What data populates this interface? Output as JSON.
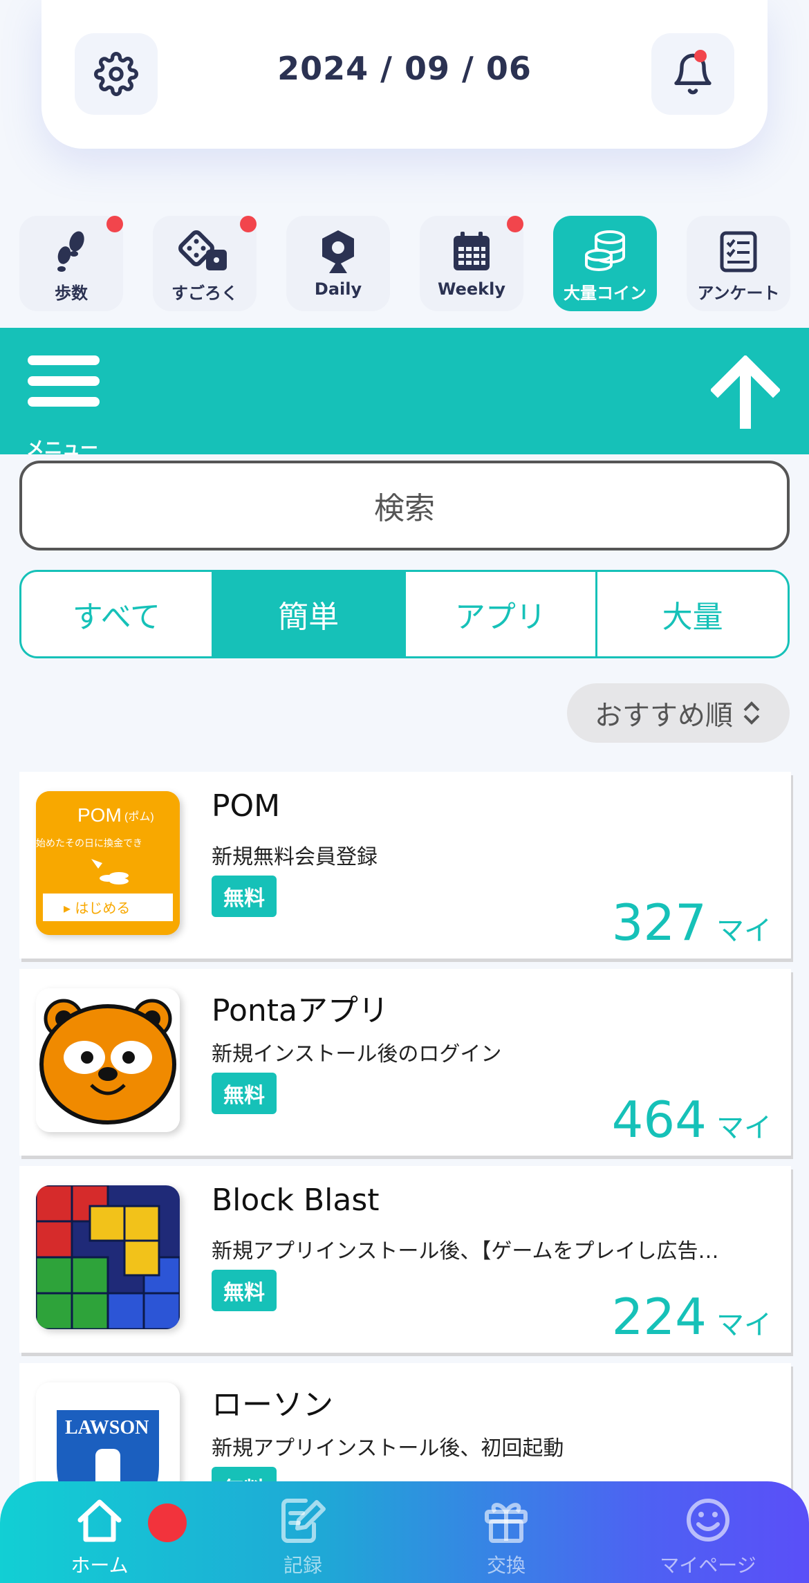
{
  "header": {
    "date": "2024 / 09 / 06"
  },
  "categories": [
    {
      "label": "歩数",
      "icon": "footprints-icon",
      "badge": true
    },
    {
      "label": "すごろく",
      "icon": "dice-icon",
      "badge": true
    },
    {
      "label": "Daily",
      "icon": "roulette-icon",
      "badge": false
    },
    {
      "label": "Weekly",
      "icon": "calendar-icon",
      "badge": true
    },
    {
      "label": "大量コイン",
      "icon": "coins-icon",
      "badge": false,
      "active": true
    },
    {
      "label": "アンケート",
      "icon": "checklist-icon",
      "badge": false
    }
  ],
  "toolbar": {
    "menu_label": "メニュー"
  },
  "search": {
    "placeholder": "検索"
  },
  "tabs": [
    {
      "label": "すべて"
    },
    {
      "label": "簡単",
      "active": true
    },
    {
      "label": "アプリ"
    },
    {
      "label": "大量"
    }
  ],
  "sort": {
    "label": "おすすめ順"
  },
  "offers": [
    {
      "title": "POM",
      "desc": "新規無料会員登録",
      "badge": "無料",
      "points": "327",
      "unit": "マイ",
      "thumb_text": {
        "brand": "POM",
        "brand_small": "(ポム)",
        "tagline": "始めたその日に換金でき",
        "cta": "▸ はじめる"
      }
    },
    {
      "title": "Pontaアプリ",
      "desc": "新規インストール後のログイン",
      "badge": "無料",
      "points": "464",
      "unit": "マイ"
    },
    {
      "title": "Block Blast",
      "desc": "新規アプリインストール後、【ゲームをプレイし広告…",
      "badge": "無料",
      "points": "224",
      "unit": "マイ"
    },
    {
      "title": "ローソン",
      "desc": "新規アプリインストール後、初回起動",
      "badge": "無料",
      "points": "",
      "unit": "",
      "thumb_text": {
        "brand": "LAWSON"
      }
    }
  ],
  "bottom_nav": [
    {
      "label": "ホーム",
      "icon": "home-icon",
      "active": true
    },
    {
      "label": "記録",
      "icon": "record-icon"
    },
    {
      "label": "交換",
      "icon": "gift-icon"
    },
    {
      "label": "マイページ",
      "icon": "smiley-icon"
    }
  ],
  "colors": {
    "accent": "#16c1b8",
    "badge_red": "#f2454c",
    "nav_dark": "#2b3252"
  }
}
